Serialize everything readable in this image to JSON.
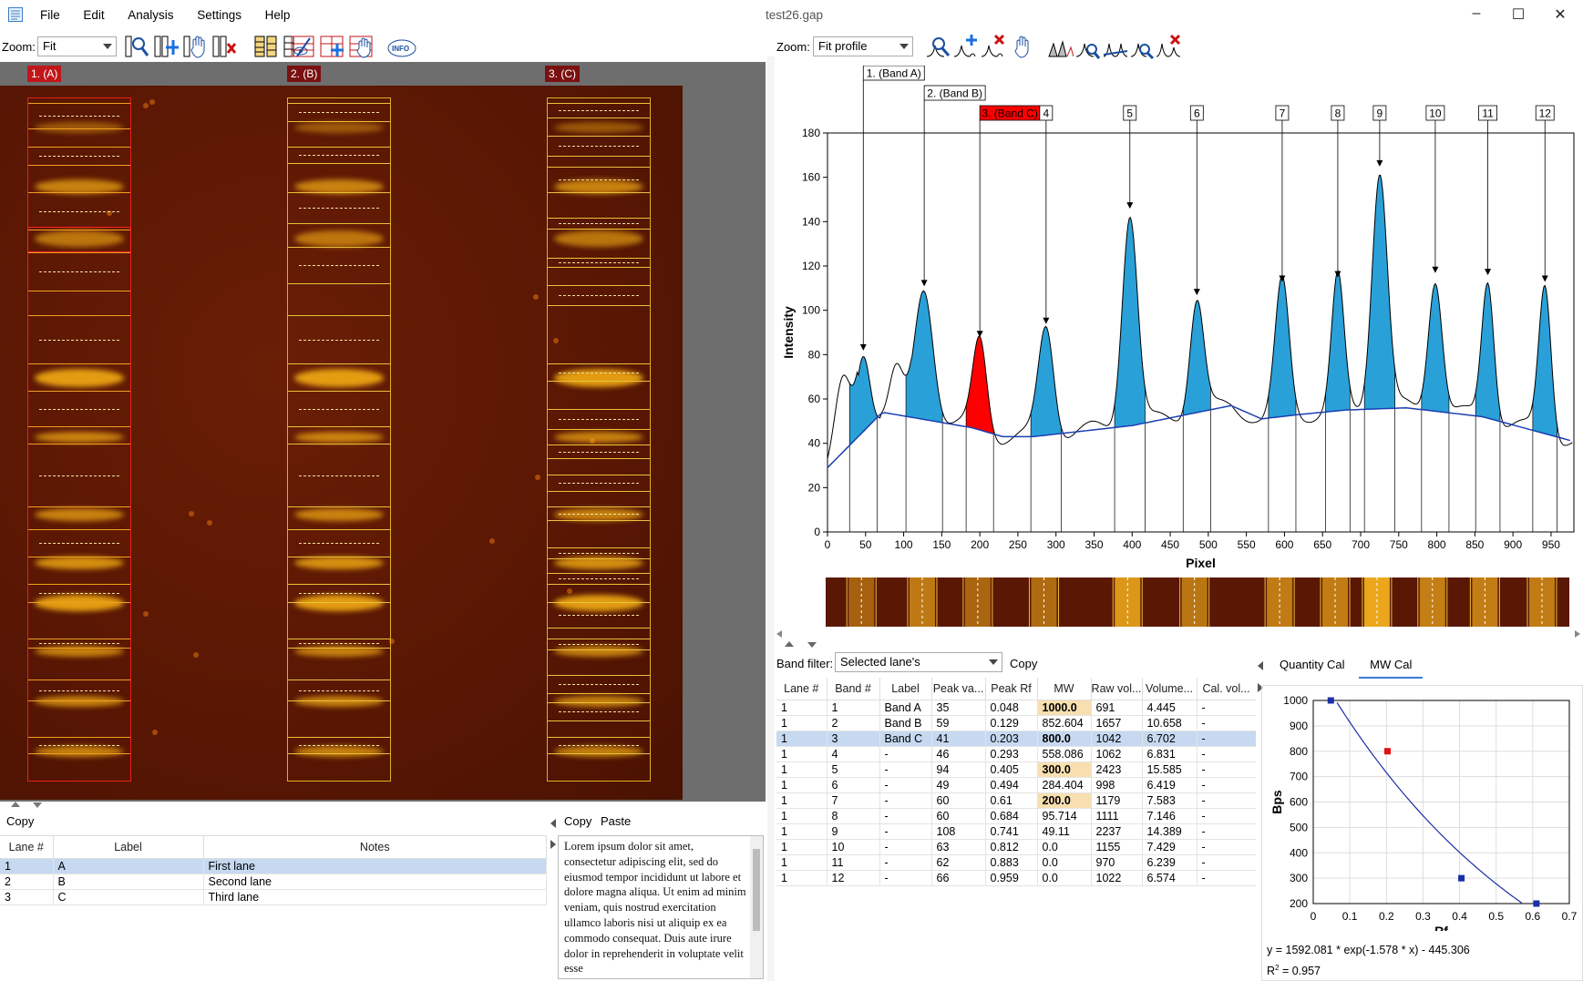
{
  "window": {
    "title": "test26.gap"
  },
  "menu": [
    "File",
    "Edit",
    "Analysis",
    "Settings",
    "Help"
  ],
  "left_toolbar": {
    "zoom_label": "Zoom:",
    "zoom_value": "Fit",
    "info_label": "INFO"
  },
  "right_toolbar": {
    "zoom_label": "Zoom:",
    "zoom_value": "Fit profile"
  },
  "lanes_tags": [
    "1. (A)",
    "2. (B)",
    "3. (C)"
  ],
  "profile_markers": [
    "1. (Band A)",
    "2. (Band B)",
    "3. (Band C)",
    "4",
    "5",
    "6",
    "7",
    "8",
    "9",
    "10",
    "11",
    "12"
  ],
  "chart_data": [
    {
      "type": "line",
      "xlabel": "Pixel",
      "ylabel": "Intensity",
      "xlim": [
        0,
        980
      ],
      "ylim": [
        0,
        180
      ],
      "x_ticks": [
        0,
        50,
        100,
        150,
        200,
        250,
        300,
        350,
        400,
        450,
        500,
        550,
        600,
        650,
        700,
        750,
        800,
        850,
        900,
        950
      ],
      "y_ticks": [
        0,
        20,
        40,
        60,
        80,
        100,
        120,
        140,
        160,
        180
      ],
      "peaks": [
        {
          "x": 47,
          "y": 81
        },
        {
          "x": 127,
          "y": 110
        },
        {
          "x": 200,
          "y": 87
        },
        {
          "x": 287,
          "y": 93
        },
        {
          "x": 397,
          "y": 145
        },
        {
          "x": 485,
          "y": 106
        },
        {
          "x": 597,
          "y": 112
        },
        {
          "x": 670,
          "y": 114
        },
        {
          "x": 725,
          "y": 164
        },
        {
          "x": 798,
          "y": 116
        },
        {
          "x": 867,
          "y": 115
        },
        {
          "x": 942,
          "y": 112
        }
      ],
      "selected_peak": 3
    },
    {
      "type": "scatter",
      "xlabel": "Rf",
      "ylabel": "Bps",
      "xlim": [
        0,
        0.7
      ],
      "ylim": [
        200,
        1000
      ],
      "x_ticks": [
        "0",
        "0.1",
        "0.2",
        "0.3",
        "0.4",
        "0.5",
        "0.6",
        "0.7"
      ],
      "y_ticks": [
        "200",
        "300",
        "400",
        "500",
        "600",
        "700",
        "800",
        "900",
        "1000"
      ],
      "points": [
        {
          "x": 0.048,
          "y": 1000,
          "color": "#1a2fa8"
        },
        {
          "x": 0.203,
          "y": 800,
          "color": "#e01010"
        },
        {
          "x": 0.405,
          "y": 300,
          "color": "#1a2fa8"
        },
        {
          "x": 0.61,
          "y": 200,
          "color": "#1a2fa8"
        }
      ],
      "fit": {
        "a": 1592.081,
        "b": -1.578,
        "c": -445.306
      }
    }
  ],
  "calibration": {
    "equation": "y = 1592.081 * exp(-1.578 * x) - 445.306",
    "r2_prefix": "R",
    "r2_sup": "2",
    "r2_value": " = 0.957"
  },
  "band_filter": {
    "label": "Band filter:",
    "value": "Selected lane's",
    "copy": "Copy"
  },
  "cal_tabs": [
    "Quantity Cal",
    "MW Cal"
  ],
  "bands_table": {
    "headers": [
      "Lane #",
      "Band #",
      "Label",
      "Peak va...",
      "Peak Rf",
      "MW",
      "Raw vol...",
      "Volume...",
      "Cal. vol..."
    ],
    "rows": [
      [
        "1",
        "1",
        "Band A",
        "35",
        "0.048",
        "1000.0",
        "691",
        "4.445",
        "-"
      ],
      [
        "1",
        "2",
        "Band B",
        "59",
        "0.129",
        "852.604",
        "1657",
        "10.658",
        "-"
      ],
      [
        "1",
        "3",
        "Band C",
        "41",
        "0.203",
        "800.0",
        "1042",
        "6.702",
        "-"
      ],
      [
        "1",
        "4",
        "-",
        "46",
        "0.293",
        "558.086",
        "1062",
        "6.831",
        "-"
      ],
      [
        "1",
        "5",
        "-",
        "94",
        "0.405",
        "300.0",
        "2423",
        "15.585",
        "-"
      ],
      [
        "1",
        "6",
        "-",
        "49",
        "0.494",
        "284.404",
        "998",
        "6.419",
        "-"
      ],
      [
        "1",
        "7",
        "-",
        "60",
        "0.61",
        "200.0",
        "1179",
        "7.583",
        "-"
      ],
      [
        "1",
        "8",
        "-",
        "60",
        "0.684",
        "95.714",
        "1111",
        "7.146",
        "-"
      ],
      [
        "1",
        "9",
        "-",
        "108",
        "0.741",
        "49.11",
        "2237",
        "14.389",
        "-"
      ],
      [
        "1",
        "10",
        "-",
        "63",
        "0.812",
        "0.0",
        "1155",
        "7.429",
        "-"
      ],
      [
        "1",
        "11",
        "-",
        "62",
        "0.883",
        "0.0",
        "970",
        "6.239",
        "-"
      ],
      [
        "1",
        "12",
        "-",
        "66",
        "0.959",
        "0.0",
        "1022",
        "6.574",
        "-"
      ]
    ]
  },
  "lanes_table": {
    "copy": "Copy",
    "headers": [
      "Lane #",
      "Label",
      "Notes"
    ],
    "rows": [
      [
        "1",
        "A",
        "First lane"
      ],
      [
        "2",
        "B",
        "Second lane"
      ],
      [
        "3",
        "C",
        "Third lane"
      ]
    ]
  },
  "notes_panel": {
    "copy": "Copy",
    "paste": "Paste",
    "text": "Lorem ipsum dolor sit amet, consectetur adipiscing elit, sed do eiusmod tempor incididunt ut labore et dolore magna aliqua. Ut enim ad minim veniam, quis nostrud exercitation ullamco laboris nisi ut aliquip ex ea commodo consequat. Duis aute irure dolor in reprehenderit in voluptate velit esse"
  },
  "colors": {
    "selection": "#c6d9f0",
    "peak_fill": "#2aa0d8",
    "selected_peak": "#ff0000",
    "lane_box": "#e0b020",
    "highlight_mw": "#f7dfb0"
  }
}
